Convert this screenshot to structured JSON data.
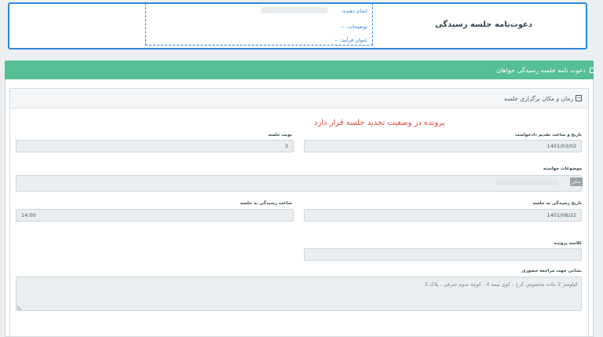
{
  "header": {
    "title": "دعوت‌نامه جلسه رسیدگی",
    "meta": {
      "executor_label": "انجام دهنده:",
      "description_label": "توضیحات: --",
      "process_title_label": "عنوان فرآیند: --"
    }
  },
  "panel": {
    "title": "دعوت نامه جلسه رسیدگی خواهان"
  },
  "section": {
    "title": "زمان و مکان برگزاری جلسه",
    "toggle": "−"
  },
  "status_message": "پرونده در وضعیت تجدید جلسه قرار دارد",
  "fields": {
    "request_date": {
      "label": "تاریخ و ساعت تقدیم دادخواست",
      "value": "1401/03/02"
    },
    "session_turn": {
      "label": "نوبت جلسه",
      "value": "3"
    },
    "request_subjects": {
      "label": "موضوعات خواسته",
      "tag": "سایر"
    },
    "hearing_date": {
      "label": "تاریخ رسیدگی به جلسه",
      "value": "1401/08/22"
    },
    "hearing_time": {
      "label": "ساعت رسیدگی به جلسه",
      "value": "14:00"
    },
    "case_class": {
      "label": "کلاسه پرونده",
      "value": ""
    },
    "address": {
      "label": "نشانی جهت مراجعه حضوری",
      "value": "کیلومتر 2 جاده مخصوص کرج ، کوی بیمه 4 ، کوچه سوم شرقی ، پلاک 3"
    }
  },
  "colors": {
    "accent_blue": "#2f86d6",
    "panel_green": "#56bf95",
    "status_red": "#e0473b"
  }
}
